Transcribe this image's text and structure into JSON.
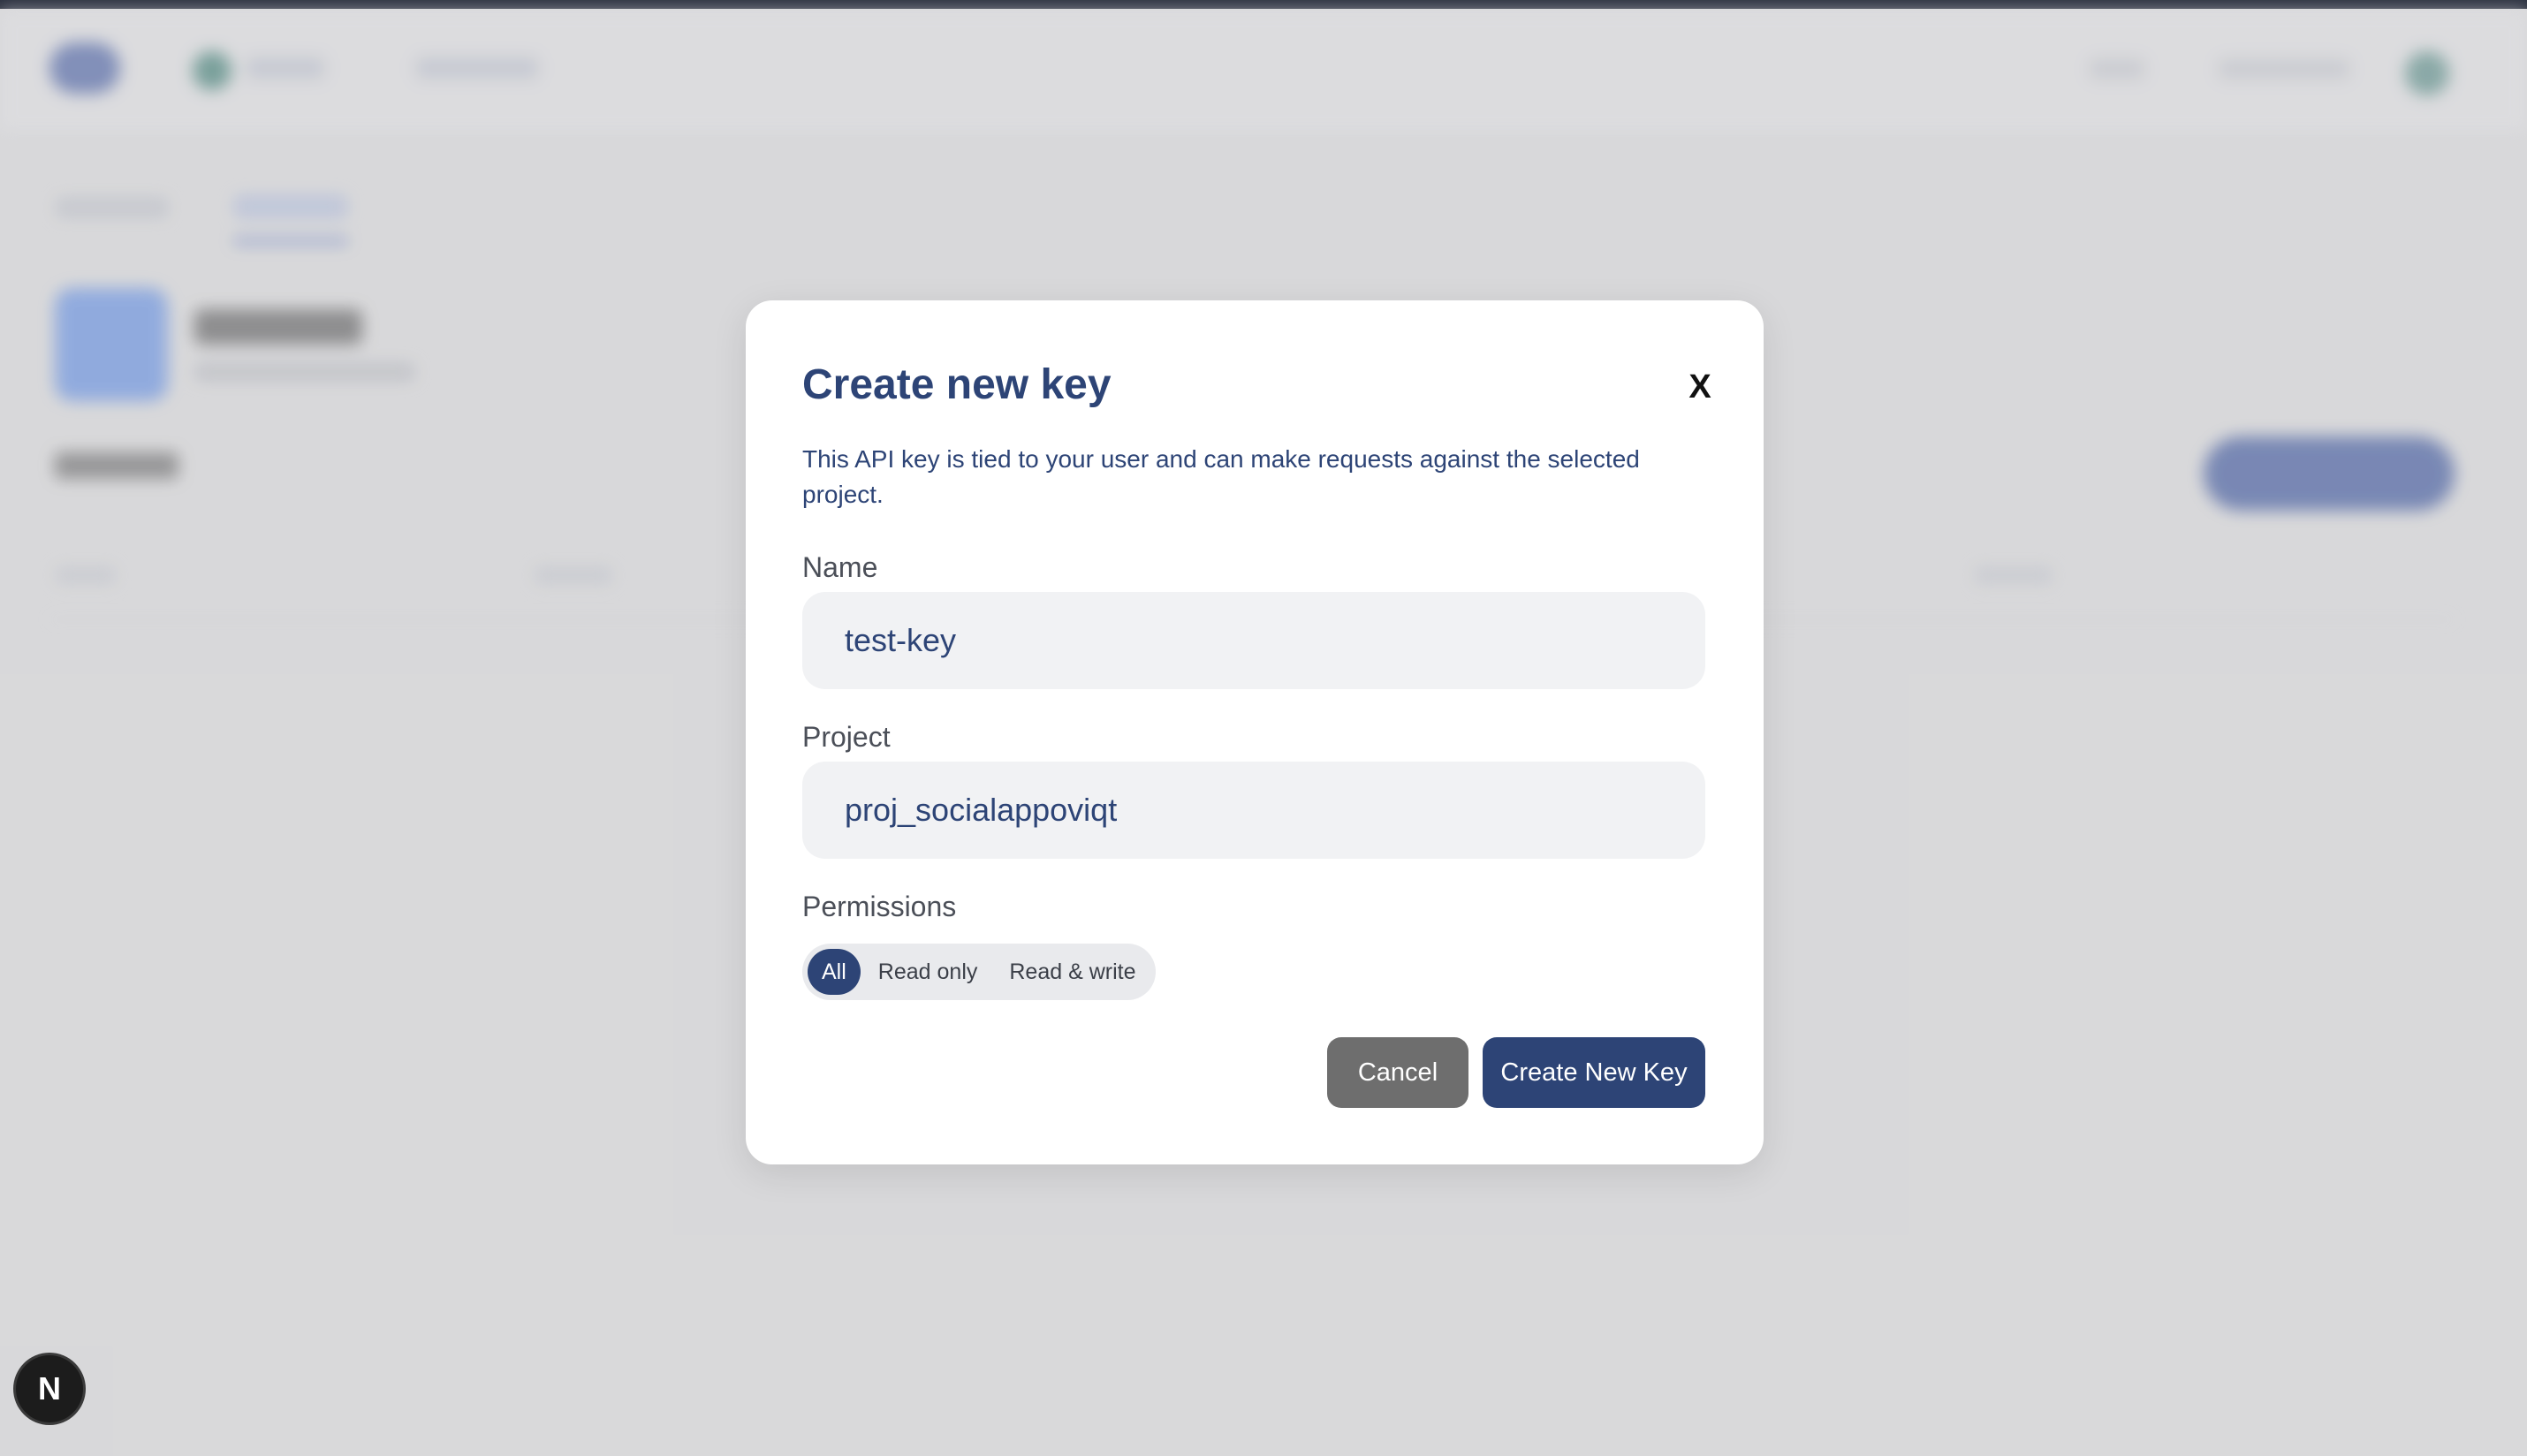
{
  "modal": {
    "title": "Create new key",
    "close_label": "X",
    "description": "This API key is tied to your user and can make requests against the selected project.",
    "name_label": "Name",
    "name_value": "test-key",
    "project_label": "Project",
    "project_value": "proj_socialappoviqt",
    "permissions_label": "Permissions",
    "permissions": [
      {
        "label": "All",
        "selected": true
      },
      {
        "label": "Read only",
        "selected": false
      },
      {
        "label": "Read & write",
        "selected": false
      }
    ],
    "cancel_label": "Cancel",
    "create_label": "Create New Key"
  },
  "dev_badge": {
    "label": "N"
  },
  "colors": {
    "primary": "#2d4476",
    "cancel": "#6e6e6e",
    "input_bg": "#f1f2f4"
  }
}
